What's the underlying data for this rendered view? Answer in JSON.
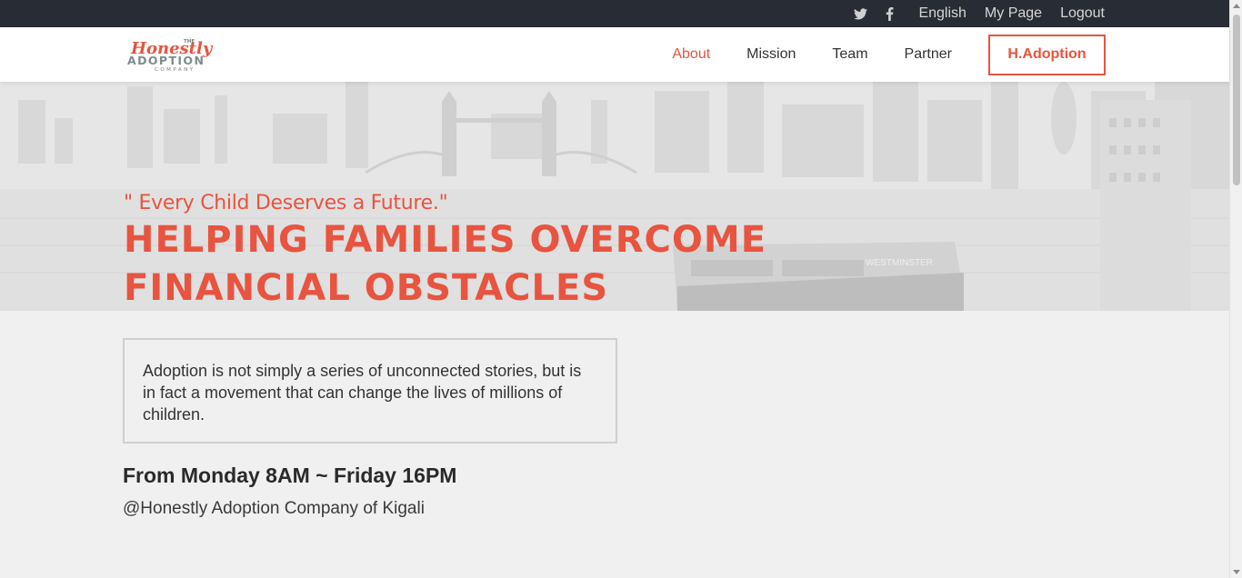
{
  "topbar": {
    "icons": [
      "twitter-icon",
      "facebook-icon"
    ],
    "links": [
      "English",
      "My Page",
      "Logout"
    ]
  },
  "logo": {
    "small_top": "THE",
    "script": "Honestly",
    "main": "ADOPTION",
    "sub": "COMPANY"
  },
  "nav": {
    "items": [
      "About",
      "Mission",
      "Team",
      "Partner"
    ],
    "active": "About",
    "cta": "H.Adoption"
  },
  "hero": {
    "quote": "\" Every Child Deserves a Future.\"",
    "headline": "HELPING FAMILIES OVERCOME FINANCIAL OBSTACLES",
    "boat_sign": "WESTMINSTER"
  },
  "intro": {
    "text": "Adoption is not simply a series of unconnected stories, but is in fact a movement that can change the lives of millions of children."
  },
  "hours": "From Monday 8AM ~ Friday 16PM",
  "location": "@Honestly Adoption Company of Kigali",
  "colors": {
    "accent": "#e8543f",
    "topbar": "#282c34",
    "background": "#f0f0f0"
  }
}
